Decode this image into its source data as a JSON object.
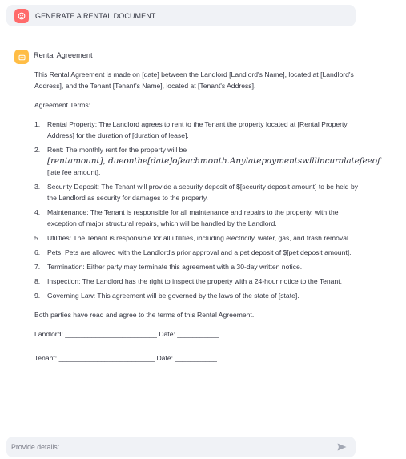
{
  "user_message": {
    "avatar_icon": "user-avatar-icon",
    "text": "GENERATE A RENTAL DOCUMENT"
  },
  "assistant": {
    "avatar_icon": "assistant-avatar-icon",
    "title": "Rental Agreement",
    "intro": "This Rental Agreement is made on [date] between the Landlord [Landlord's Name], located at [Landlord's Address], and the Tenant [Tenant's Name], located at [Tenant's Address].",
    "terms_heading": "Agreement Terms:",
    "terms": [
      {
        "num": "1.",
        "text": "Rental Property: The Landlord agrees to rent to the Tenant the property located at [Rental Property Address] for the duration of [duration of lease]."
      },
      {
        "num": "2.",
        "text": "Rent: The monthly rent for the property will be",
        "math": "[rentamount], dueonthe[date]ofeachmonth.Anylatepaymentswillincuralatefeeof",
        "tail": "[late fee amount]."
      },
      {
        "num": "3.",
        "text": "Security Deposit: The Tenant will provide a security deposit of $[security deposit amount] to be held by the Landlord as security for damages to the property."
      },
      {
        "num": "4.",
        "text": "Maintenance: The Tenant is responsible for all maintenance and repairs to the property, with the exception of major structural repairs, which will be handled by the Landlord."
      },
      {
        "num": "5.",
        "text": "Utilities: The Tenant is responsible for all utilities, including electricity, water, gas, and trash removal."
      },
      {
        "num": "6.",
        "text": "Pets: Pets are allowed with the Landlord's prior approval and a pet deposit of $[pet deposit amount]."
      },
      {
        "num": "7.",
        "text": "Termination: Either party may terminate this agreement with a 30-day written notice."
      },
      {
        "num": "8.",
        "text": "Inspection: The Landlord has the right to inspect the property with a 24-hour notice to the Tenant."
      },
      {
        "num": "9.",
        "text": "Governing Law: This agreement will be governed by the laws of the state of [state]."
      }
    ],
    "closing": "Both parties have read and agree to the terms of this Rental Agreement.",
    "landlord_line": "Landlord: ________________________ Date: ___________",
    "tenant_line": "Tenant: _________________________ Date: ___________"
  },
  "chat_input": {
    "placeholder": "Provide details:",
    "send_icon": "send-icon"
  }
}
